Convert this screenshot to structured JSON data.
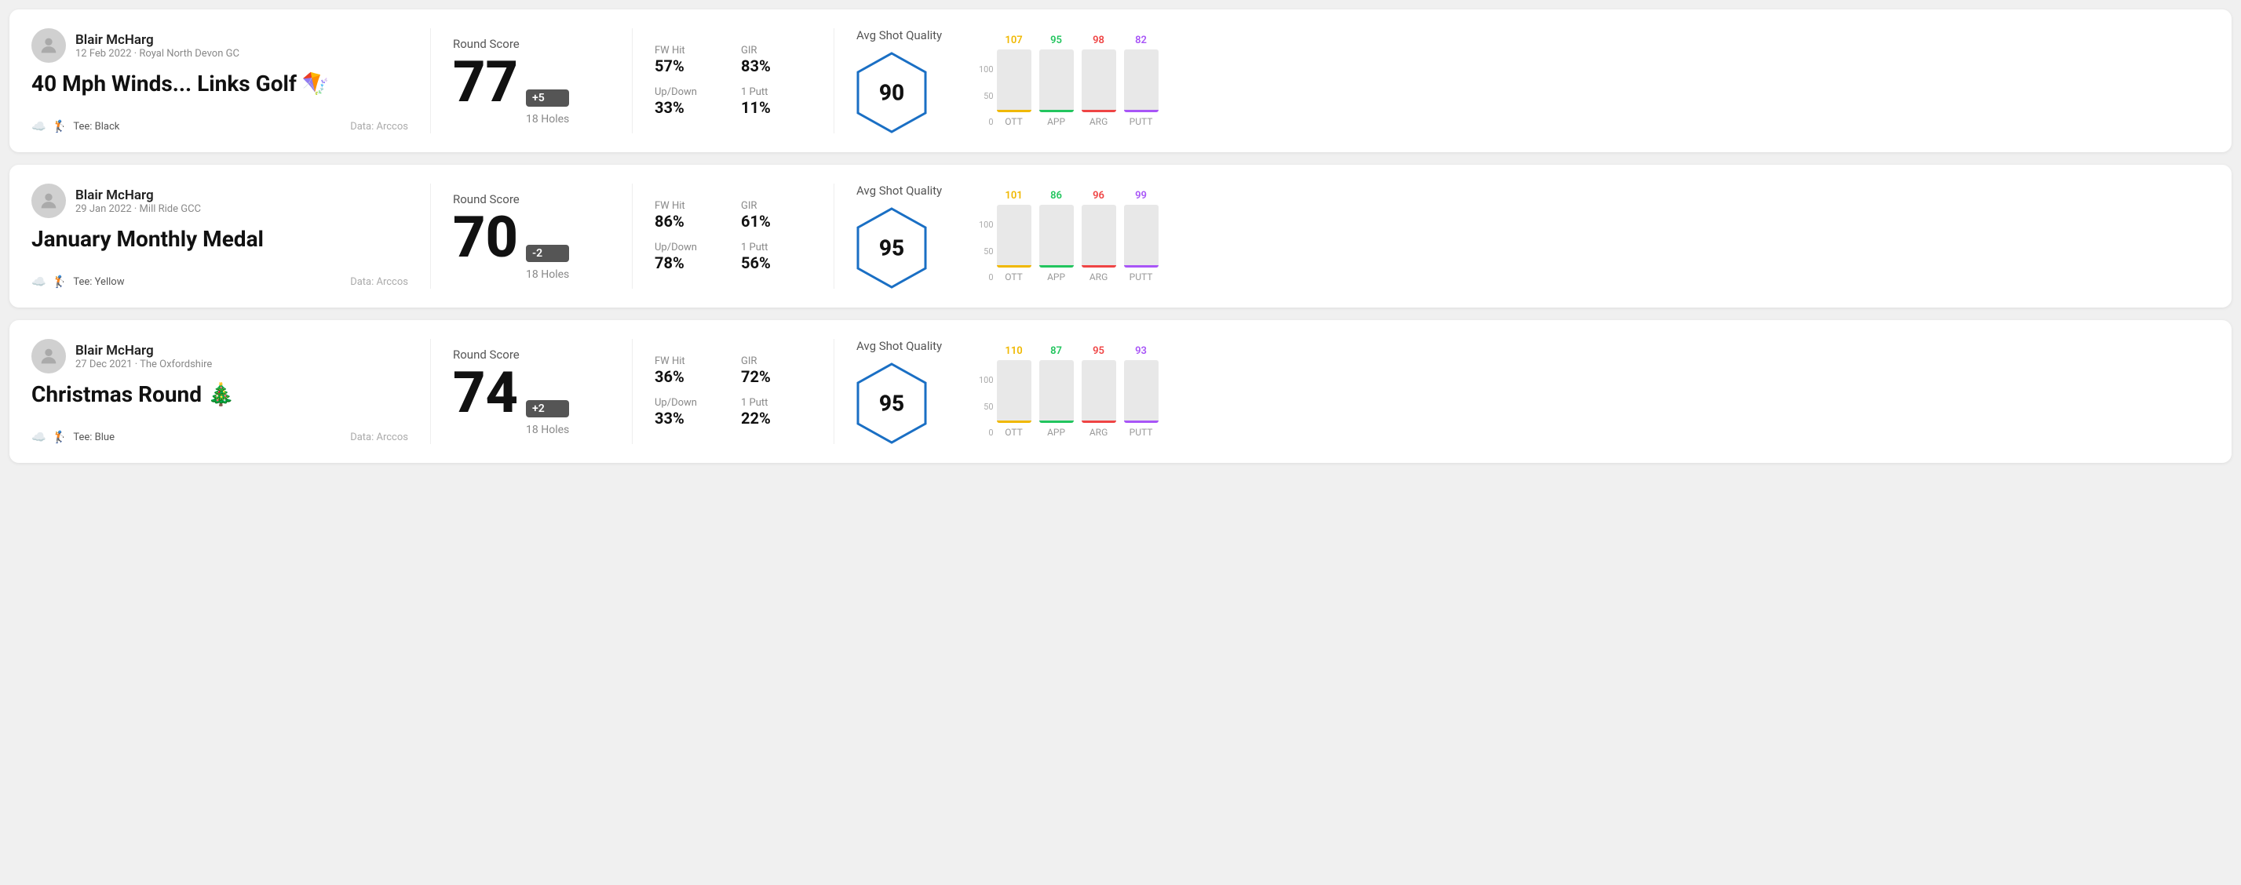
{
  "rounds": [
    {
      "id": "round1",
      "player_name": "Blair McHarg",
      "player_meta": "12 Feb 2022 · Royal North Devon GC",
      "round_title": "40 Mph Winds... Links Golf 🪁",
      "tee": "Black",
      "data_source": "Data: Arccos",
      "score": "77",
      "score_badge": "+5",
      "score_badge_type": "plus",
      "holes": "18 Holes",
      "fw_hit": "57%",
      "gir": "83%",
      "up_down": "33%",
      "one_putt": "11%",
      "avg_shot_quality": "90",
      "chart": {
        "bars": [
          {
            "label": "OTT",
            "value": 107,
            "color": "#f0b800",
            "pct": 75
          },
          {
            "label": "APP",
            "value": 95,
            "color": "#22c55e",
            "pct": 62
          },
          {
            "label": "ARG",
            "value": 98,
            "color": "#ef4444",
            "pct": 65
          },
          {
            "label": "PUTT",
            "value": 82,
            "color": "#a855f7",
            "pct": 54
          }
        ],
        "y_labels": [
          "100",
          "50",
          "0"
        ]
      }
    },
    {
      "id": "round2",
      "player_name": "Blair McHarg",
      "player_meta": "29 Jan 2022 · Mill Ride GCC",
      "round_title": "January Monthly Medal",
      "tee": "Yellow",
      "data_source": "Data: Arccos",
      "score": "70",
      "score_badge": "-2",
      "score_badge_type": "minus",
      "holes": "18 Holes",
      "fw_hit": "86%",
      "gir": "61%",
      "up_down": "78%",
      "one_putt": "56%",
      "avg_shot_quality": "95",
      "chart": {
        "bars": [
          {
            "label": "OTT",
            "value": 101,
            "color": "#f0b800",
            "pct": 67
          },
          {
            "label": "APP",
            "value": 86,
            "color": "#22c55e",
            "pct": 57
          },
          {
            "label": "ARG",
            "value": 96,
            "color": "#ef4444",
            "pct": 64
          },
          {
            "label": "PUTT",
            "value": 99,
            "color": "#a855f7",
            "pct": 66
          }
        ],
        "y_labels": [
          "100",
          "50",
          "0"
        ]
      }
    },
    {
      "id": "round3",
      "player_name": "Blair McHarg",
      "player_meta": "27 Dec 2021 · The Oxfordshire",
      "round_title": "Christmas Round 🎄",
      "tee": "Blue",
      "data_source": "Data: Arccos",
      "score": "74",
      "score_badge": "+2",
      "score_badge_type": "plus",
      "holes": "18 Holes",
      "fw_hit": "36%",
      "gir": "72%",
      "up_down": "33%",
      "one_putt": "22%",
      "avg_shot_quality": "95",
      "chart": {
        "bars": [
          {
            "label": "OTT",
            "value": 110,
            "color": "#f0b800",
            "pct": 73
          },
          {
            "label": "APP",
            "value": 87,
            "color": "#22c55e",
            "pct": 58
          },
          {
            "label": "ARG",
            "value": 95,
            "color": "#ef4444",
            "pct": 63
          },
          {
            "label": "PUTT",
            "value": 93,
            "color": "#a855f7",
            "pct": 62
          }
        ],
        "y_labels": [
          "100",
          "50",
          "0"
        ]
      }
    }
  ],
  "labels": {
    "round_score": "Round Score",
    "fw_hit": "FW Hit",
    "gir": "GIR",
    "up_down": "Up/Down",
    "one_putt": "1 Putt",
    "avg_shot_quality": "Avg Shot Quality",
    "tee_prefix": "Tee:"
  }
}
